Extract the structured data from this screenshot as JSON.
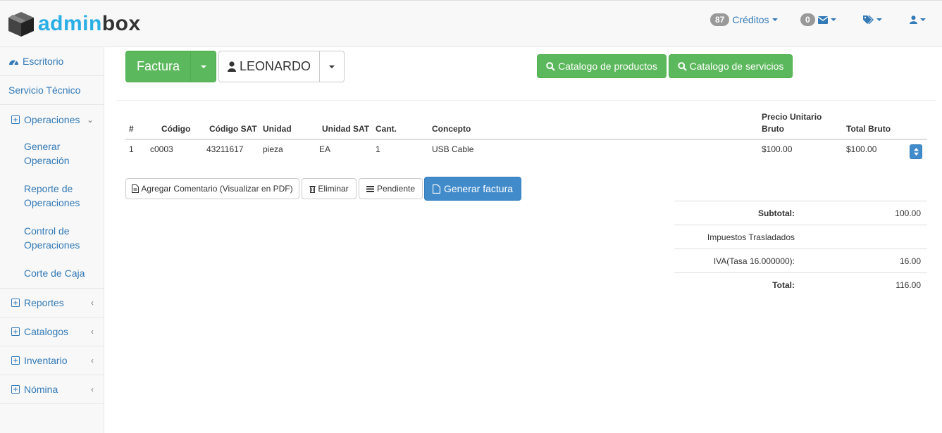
{
  "brand": {
    "part1": "admin",
    "part2": "box"
  },
  "topbar": {
    "credits_count": "87",
    "credits_label": "Créditos",
    "messages_count": "0"
  },
  "sidebar": {
    "items": [
      {
        "label": "Escritorio",
        "icon": "dashboard-icon"
      },
      {
        "label": "Servicio Técnico"
      },
      {
        "label": "Operaciones",
        "icon": "plus-square-icon",
        "expanded": true
      },
      {
        "label": "Reportes",
        "icon": "plus-square-icon"
      },
      {
        "label": "Catalogos",
        "icon": "plus-square-icon"
      },
      {
        "label": "Inventario",
        "icon": "plus-square-icon"
      },
      {
        "label": "Nómina",
        "icon": "plus-square-icon"
      }
    ],
    "subitems": [
      {
        "line1": "Generar",
        "line2": "Operación"
      },
      {
        "line1": "Reporte de",
        "line2": "Operaciones"
      },
      {
        "line1": "Control de",
        "line2": "Operaciones"
      },
      {
        "line1": "Corte de Caja",
        "line2": ""
      }
    ]
  },
  "toolbar": {
    "doc_type": "Factura",
    "client": "LEONARDO",
    "catalog_products": "Catalogo de productos",
    "catalog_services": "Catalogo de servicios"
  },
  "table": {
    "headers": [
      "#",
      "Código",
      "Código SAT",
      "Unidad",
      "Unidad SAT",
      "Cant.",
      "Concepto",
      "Precio Unitario",
      "Bruto",
      "Total Bruto"
    ],
    "rows": [
      [
        "1",
        "c0003",
        "43211617",
        "pieza",
        "EA",
        "1",
        "USB Cable",
        "$100.00",
        "$100.00"
      ]
    ]
  },
  "actions": {
    "comment": "Agregar Comentario (Visualizar en PDF)",
    "delete": "Eliminar",
    "pending": "Pendiente",
    "invoice": "Generar factura"
  },
  "totals": [
    {
      "label": "Subtotal:",
      "value": "100.00",
      "bold": true
    },
    {
      "label": "Impuestos Trasladados",
      "value": "",
      "bold": false
    },
    {
      "label": "IVA(Tasa 16.000000):",
      "value": "16.00",
      "bold": false
    },
    {
      "label": "Total:",
      "value": "116.00",
      "bold": true
    }
  ],
  "colors": {
    "accent": "#337ab7",
    "green": "#5cb85c",
    "blue": "#428bca",
    "logo_blue": "#29aee6"
  }
}
